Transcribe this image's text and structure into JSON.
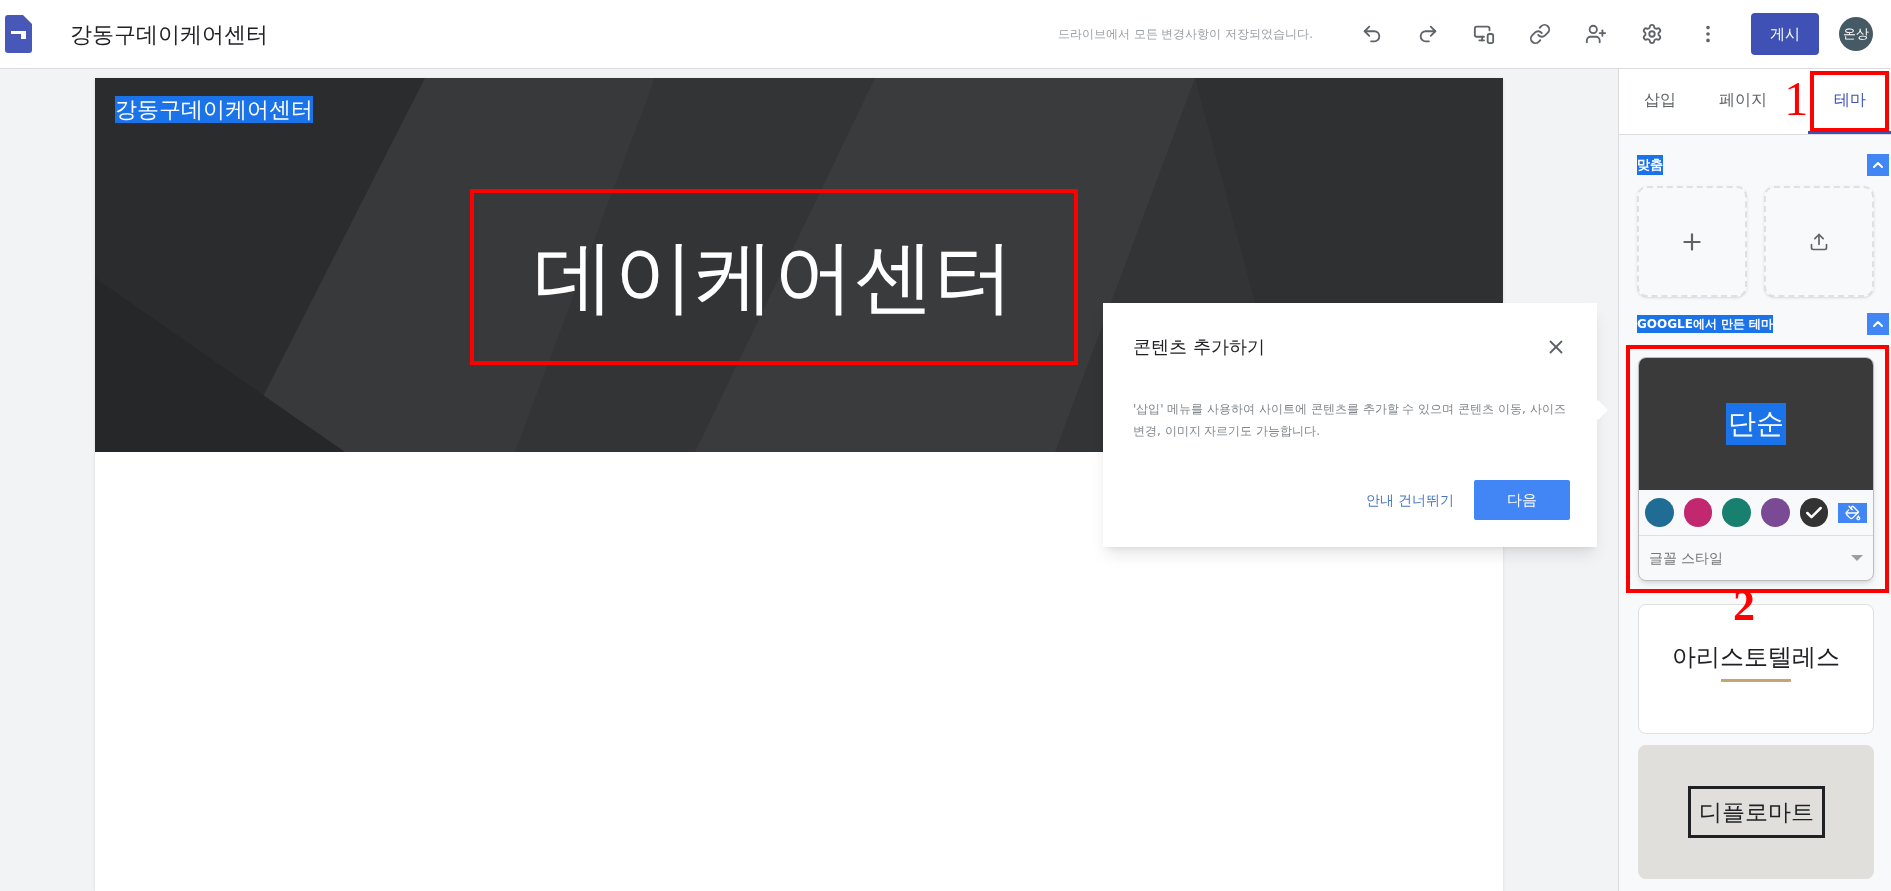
{
  "app": {
    "title": "강동구데이케어센터",
    "save_status": "드라이브에서 모든 변경사항이 저장되었습니다.",
    "publish_button": "게시",
    "avatar": "온상"
  },
  "site": {
    "site_name": {
      "text": "강동구데이케어센터",
      "highlighted": true
    },
    "page_title": "데이케어센터"
  },
  "popup": {
    "title": "콘텐츠 추가하기",
    "body": "'삽입' 메뉴를 사용하여 사이트에 콘텐츠를 추가할 수 있으며 콘텐츠 이동, 사이즈 변경, 이미지 자르기도 가능합니다.",
    "skip_link": "안내 건너뛰기",
    "next_button": "다음"
  },
  "panel": {
    "tabs": [
      {
        "label": "삽입",
        "selected": false
      },
      {
        "label": "페이지",
        "selected": false
      },
      {
        "label": "테마",
        "selected": true
      }
    ],
    "custom": {
      "title": "맞춤",
      "highlighted": true,
      "expanded": true
    },
    "google_themes": {
      "title": "GOOGLE에서 만든 테마",
      "highlighted": true,
      "expanded": true,
      "themes": [
        {
          "kind": "simple",
          "name": "단순",
          "name_highlighted": true,
          "selected": true,
          "font_style": "글꼴 스타일",
          "swatches": [
            {
              "color": "#1f6d94",
              "selected": false
            },
            {
              "color": "#c2286f",
              "selected": false
            },
            {
              "color": "#18806e",
              "selected": false
            },
            {
              "color": "#7b4a94",
              "selected": false
            },
            {
              "color": "#333333",
              "selected": true
            }
          ]
        },
        {
          "kind": "aristotle",
          "name": "아리스토텔레스",
          "selected": false
        },
        {
          "kind": "diplomat",
          "name": "디플로마트",
          "selected": false
        }
      ]
    }
  },
  "annotations": [
    {
      "label": "1"
    },
    {
      "label": "2"
    }
  ]
}
